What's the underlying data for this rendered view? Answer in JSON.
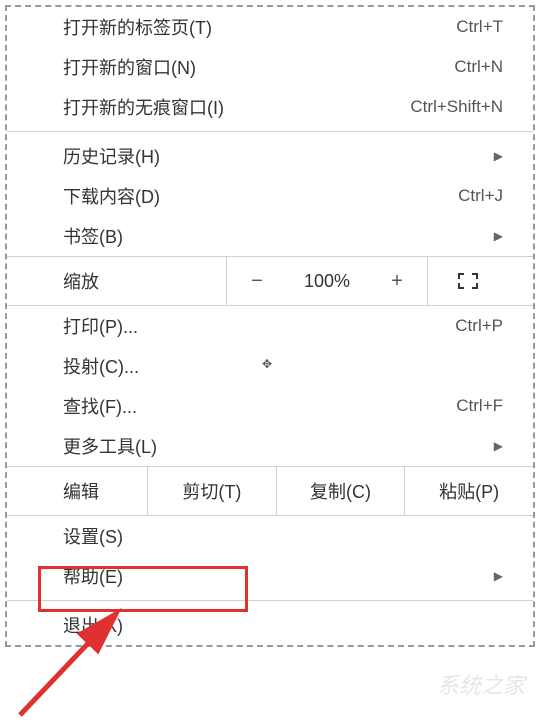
{
  "menu": {
    "new_tab": {
      "label": "打开新的标签页(T)",
      "shortcut": "Ctrl+T"
    },
    "new_window": {
      "label": "打开新的窗口(N)",
      "shortcut": "Ctrl+N"
    },
    "new_incognito": {
      "label": "打开新的无痕窗口(I)",
      "shortcut": "Ctrl+Shift+N"
    },
    "history": {
      "label": "历史记录(H)"
    },
    "downloads": {
      "label": "下载内容(D)",
      "shortcut": "Ctrl+J"
    },
    "bookmarks": {
      "label": "书签(B)"
    },
    "zoom": {
      "label": "缩放",
      "value": "100%"
    },
    "print": {
      "label": "打印(P)...",
      "shortcut": "Ctrl+P"
    },
    "cast": {
      "label": "投射(C)..."
    },
    "find": {
      "label": "查找(F)...",
      "shortcut": "Ctrl+F"
    },
    "more_tools": {
      "label": "更多工具(L)"
    },
    "edit": {
      "label": "编辑",
      "cut": "剪切(T)",
      "copy": "复制(C)",
      "paste": "粘贴(P)"
    },
    "settings": {
      "label": "设置(S)"
    },
    "help": {
      "label": "帮助(E)"
    },
    "exit": {
      "label": "退出(X)"
    }
  },
  "watermark": "系统之家"
}
